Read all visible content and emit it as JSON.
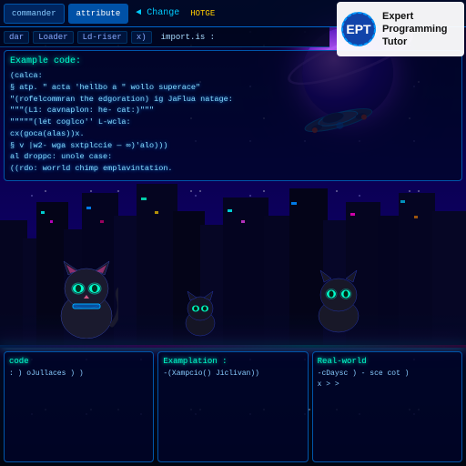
{
  "app": {
    "title": "Expert Programming Tutor"
  },
  "header": {
    "tabs": [
      {
        "label": "commander",
        "active": false
      },
      {
        "label": "attribute",
        "active": true
      }
    ],
    "arrow_label": "◄ Change",
    "hotkey_label": "HOTGE"
  },
  "subnav": {
    "items": [
      {
        "label": "dar"
      },
      {
        "label": "Loader"
      },
      {
        "label": "Ld-riser"
      },
      {
        "label": "x)"
      }
    ],
    "prompt": "import.is :"
  },
  "code_panel": {
    "title": "Example code:",
    "lines": [
      "(calca:",
      "  § atp. \" acta 'hellbo a \" wollo superace\"",
      "  \"(rofelcommran   the edgoration)  ig JaFlua natage:",
      "  \"\"\"(L1: cavnaplon: he- cat:)\"\"\"",
      "  \"\"\"\"\"(let coglco'' L-wcla:",
      "",
      "  cx(goca(alas))x.",
      "  § v |w2- wga sxtplccie — ∞)'alo)))",
      "",
      "al droppc:     unole case:",
      "  ((rdo: worrld chimp  emplavintation."
    ]
  },
  "bottom_panels": [
    {
      "id": "code",
      "title": "code",
      "lines": [
        ": ) oJullaces ) )"
      ]
    },
    {
      "id": "explanation",
      "title": "Examplation :",
      "lines": [
        "-(Xampcio()  Jiclivan))"
      ]
    },
    {
      "id": "realworld",
      "title": "Real-world",
      "lines": [
        "-cDaysc ) - sce cot )",
        "x > >"
      ]
    }
  ],
  "logo": {
    "title": "Expert Programming Tutor",
    "icon_letters": "EPT"
  }
}
